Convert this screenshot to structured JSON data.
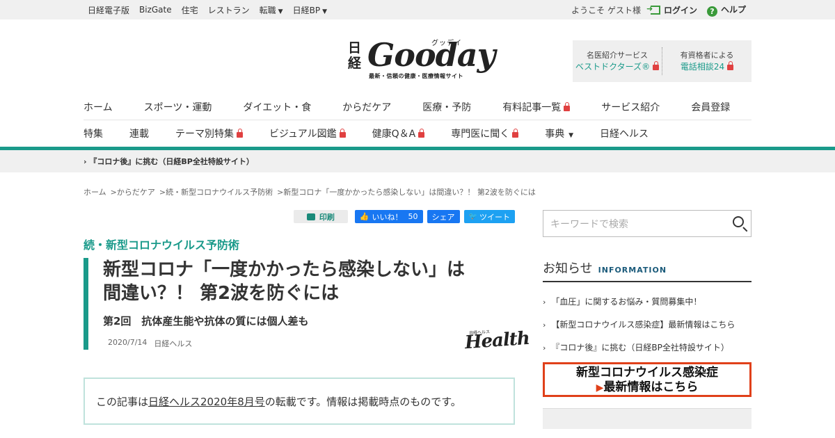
{
  "topbar": {
    "links": [
      "日経電子版",
      "BizGate",
      "住宅",
      "レストラン",
      "転職",
      "日経BP"
    ],
    "welcome": "ようこそ ゲスト様",
    "login": "ログイン",
    "help": "ヘルプ"
  },
  "logo": {
    "nikkei": "日経",
    "word": "Gooday",
    "ruby": "グッデイ",
    "tagline": "最新・信頼の健康・医療情報サイト"
  },
  "services": {
    "left": {
      "line1": "名医紹介サービス",
      "line2": "ベストドクターズ®"
    },
    "right": {
      "line1": "有資格者による",
      "line2": "電話相談24"
    }
  },
  "nav1": [
    "ホーム",
    "スポーツ・運動",
    "ダイエット・食",
    "からだケア",
    "医療・予防",
    "有料記事一覧",
    "サービス紹介",
    "会員登録"
  ],
  "nav2": [
    "特集",
    "連載",
    "テーマ別特集",
    "ビジュアル図鑑",
    "健康Q＆A",
    "専門医に聞く",
    "事典",
    "日経ヘルス"
  ],
  "subbar": "『コロナ後』に挑む（日経BP全社特設サイト）",
  "breadcrumb": [
    "ホーム",
    ">からだケア",
    ">続・新型コロナウイルス予防術",
    ">新型コロナ「一度かかったら感染しない」は間違い？！ 第2波を防ぐには"
  ],
  "share": {
    "print": "印刷",
    "like": "いいね！",
    "like_count": "50",
    "share": "シェア",
    "tweet": "ツイート"
  },
  "article": {
    "series": "続・新型コロナウイルス予防術",
    "title_line1": "新型コロナ「一度かかったら感染しない」は",
    "title_line2": "間違い？！ 第2波を防ぐには",
    "subtitle": "第2回　抗体産生能や抗体の質には個人差も",
    "date": "2020/7/14",
    "source": "日経ヘルス",
    "logo_word": "Health",
    "logo_small": "日経ヘルス",
    "notice_prefix": "この記事は",
    "notice_link": "日経ヘルス2020年8月号",
    "notice_suffix": "の転載です。情報は掲載時点のものです。"
  },
  "sidebar": {
    "search_placeholder": "キーワードで検索",
    "info_title": "お知らせ",
    "info_en": "INFORMATION",
    "info_items": [
      "「血圧」に関するお悩み・質問募集中！",
      "【新型コロナウイルス感染症】最新情報はこちら",
      "『コロナ後』に挑む（日経BP全社特設サイト）"
    ],
    "banner_line1": "新型コロナウイルス感染症",
    "banner_line2": "最新情報はこちら"
  }
}
